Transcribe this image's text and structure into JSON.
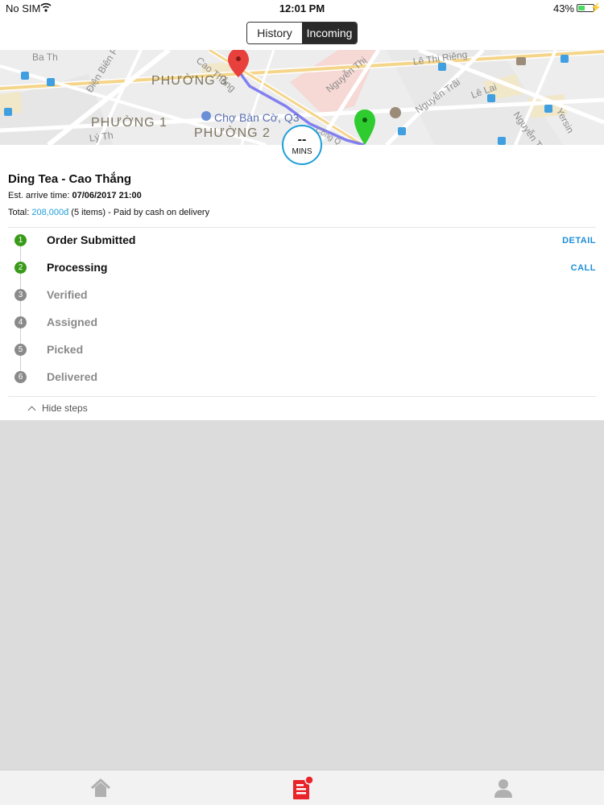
{
  "status_bar": {
    "carrier": "No SIM",
    "time": "12:01 PM",
    "battery": "43%",
    "battery_level": 0.43
  },
  "nav": {
    "segments": [
      "History",
      "Incoming"
    ],
    "selected": "Incoming"
  },
  "map": {
    "labels": [
      "Ba Th",
      "PHƯỜNG 3",
      "PHƯỜNG 1",
      "PHƯỜNG 2",
      "Chợ Bàn Cờ, Q3",
      "Điện Biên Phủ",
      "Cao Thắng",
      "Nguyễn Thị",
      "Lê Thị Riêng",
      "Nguyễn Trãi",
      "Lê Lai",
      "Nguyễn T",
      "Yersin",
      "Lý Th",
      "Cống Q"
    ],
    "origin_pin_color": "#e8413d",
    "destination_pin_color": "#2ecc2e",
    "route_color": "#6f6cf0"
  },
  "eta": {
    "value": "--",
    "unit": "MINS"
  },
  "order": {
    "shop_name": "Ding Tea - Cao Thắng",
    "arrive_label": "Est. arrive time: ",
    "arrive_value": "07/06/2017 21:00",
    "total_label": "Total: ",
    "total_amount": "208,000đ",
    "total_suffix": " (5 items) - Paid by cash on delivery"
  },
  "steps": [
    {
      "number": "1",
      "name": "Order Submitted",
      "done": true,
      "action": "DETAIL"
    },
    {
      "number": "2",
      "name": "Processing",
      "done": true,
      "action": "CALL"
    },
    {
      "number": "3",
      "name": "Verified",
      "done": false,
      "action": ""
    },
    {
      "number": "4",
      "name": "Assigned",
      "done": false,
      "action": ""
    },
    {
      "number": "5",
      "name": "Picked",
      "done": false,
      "action": ""
    },
    {
      "number": "6",
      "name": "Delivered",
      "done": false,
      "action": ""
    }
  ],
  "hide_steps_label": "Hide steps",
  "tabs": [
    {
      "icon": "home-icon",
      "active": false
    },
    {
      "icon": "orders-icon",
      "active": true,
      "badge": true
    },
    {
      "icon": "profile-icon",
      "active": false
    }
  ],
  "colors": {
    "accent": "#1e9fd8",
    "done_green": "#3a9a1a",
    "todo_gray": "#8a8a8a",
    "active_tab": "#e8232a",
    "inactive_tab": "#b0b0b0"
  }
}
